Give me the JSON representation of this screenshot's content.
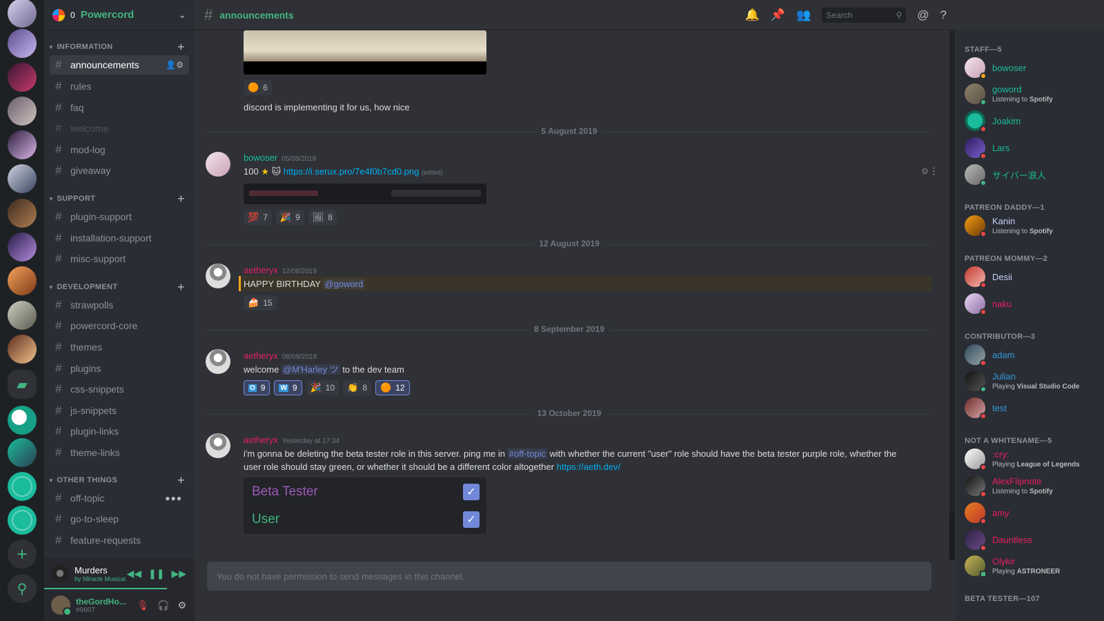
{
  "guild": {
    "name": "Powercord",
    "count": "0"
  },
  "categories": [
    {
      "label": "INFORMATION",
      "channels": [
        {
          "name": "announcements",
          "state": "active"
        },
        {
          "name": "rules"
        },
        {
          "name": "faq"
        },
        {
          "name": "welcome",
          "state": "muted"
        },
        {
          "name": "mod-log"
        },
        {
          "name": "giveaway"
        }
      ]
    },
    {
      "label": "SUPPORT",
      "channels": [
        {
          "name": "plugin-support"
        },
        {
          "name": "installation-support"
        },
        {
          "name": "misc-support"
        }
      ]
    },
    {
      "label": "DEVELOPMENT",
      "channels": [
        {
          "name": "strawpolls"
        },
        {
          "name": "powercord-core"
        },
        {
          "name": "themes"
        },
        {
          "name": "plugins"
        },
        {
          "name": "css-snippets"
        },
        {
          "name": "js-snippets"
        },
        {
          "name": "plugin-links"
        },
        {
          "name": "theme-links"
        }
      ]
    },
    {
      "label": "OTHER THINGS",
      "channels": [
        {
          "name": "off-topic"
        },
        {
          "name": "go-to-sleep"
        },
        {
          "name": "feature-requests"
        }
      ]
    }
  ],
  "now_playing": {
    "title": "Murders",
    "artist": "by Miracle Musical"
  },
  "user": {
    "name": "theGordHo...",
    "tag": "#9607"
  },
  "header": {
    "channel": "announcements",
    "search_placeholder": "Search"
  },
  "messages": {
    "top_reaction_count": "6",
    "top_text": "discord is implementing it for us, how nice",
    "div1": "5 August 2019",
    "m1": {
      "author": "bowoser",
      "ts": "05/08/2019",
      "prefix": "100",
      "link": "https://i.serux.pro/7e4f0b7cd0.png",
      "edited": "(edited)",
      "reactions": [
        "7",
        "9",
        "8"
      ]
    },
    "div2": "12 August 2019",
    "m2": {
      "author": "aetheryx",
      "ts": "12/08/2019",
      "text": "HAPPY BIRTHDAY",
      "mention": "@goword",
      "reaction": "15"
    },
    "div3": "8 September 2019",
    "m3": {
      "author": "aetheryx",
      "ts": "08/09/2019",
      "pre": "welcome",
      "mention": "@M'Harley ツ",
      "post": "to the dev team",
      "reactions": [
        "9",
        "9",
        "10",
        "8",
        "12"
      ]
    },
    "div4": "13 October 2019",
    "m4": {
      "author": "aetheryx",
      "ts": "Yesterday at 17:34",
      "line1a": "i'm gonna be deleting the beta tester role in this server. ping me in",
      "channel_mention": "#off-topic",
      "line1b": "with whether the current \"user\" role should have the beta tester purple role, whether the",
      "line2": "user role should stay green, or whether it should be a different color altogether",
      "link": "https://aeth.dev/",
      "roles": [
        "Beta Tester",
        "User"
      ]
    },
    "composer_placeholder": "You do not have permission to send messages in this channel."
  },
  "members": {
    "groups": [
      {
        "label": "STAFF—5",
        "items": [
          {
            "name": "bowoser",
            "color": "#1abc9c"
          },
          {
            "name": "goword",
            "color": "#1abc9c",
            "activity": "Listening to",
            "activity_bold": "Spotify"
          },
          {
            "name": "Joakim",
            "color": "#1abc9c"
          },
          {
            "name": "Lars",
            "color": "#1abc9c"
          },
          {
            "name": "サイバー浪人",
            "color": "#1abc9c"
          }
        ]
      },
      {
        "label": "PATREON DADDY—1",
        "items": [
          {
            "name": "Kanin",
            "color": "#c9d1ff",
            "activity": "Listening to",
            "activity_bold": "Spotify"
          }
        ]
      },
      {
        "label": "PATREON MOMMY—2",
        "items": [
          {
            "name": "Desii",
            "color": "#c9d1ff"
          },
          {
            "name": "naku",
            "color": "#e91e63"
          }
        ]
      },
      {
        "label": "CONTRIBUTOR—3",
        "items": [
          {
            "name": "adam",
            "color": "#3498db"
          },
          {
            "name": "Julian",
            "color": "#3498db",
            "activity": "Playing",
            "activity_bold": "Visual Studio Code"
          },
          {
            "name": "test",
            "color": "#3498db"
          }
        ]
      },
      {
        "label": "NOT A WHITENAME—5",
        "items": [
          {
            "name": ":cry:",
            "color": "#e91e63",
            "activity": "Playing",
            "activity_bold": "League of Legends"
          },
          {
            "name": "AlexFlipnote",
            "color": "#e91e63",
            "activity": "Listening to",
            "activity_bold": "Spotify"
          },
          {
            "name": "amy",
            "color": "#e91e63"
          },
          {
            "name": "Dauntless",
            "color": "#e91e63"
          },
          {
            "name": "Olykir",
            "color": "#e91e63",
            "activity": "Playing",
            "activity_bold": "ASTRONEER"
          }
        ]
      },
      {
        "label": "BETA TESTER—107",
        "items": []
      }
    ]
  },
  "colors": {
    "accent": "#43b581",
    "blurple": "#7289da",
    "staff": "#1abc9c",
    "danger": "#e91e63",
    "beta": "#9b59b6"
  }
}
